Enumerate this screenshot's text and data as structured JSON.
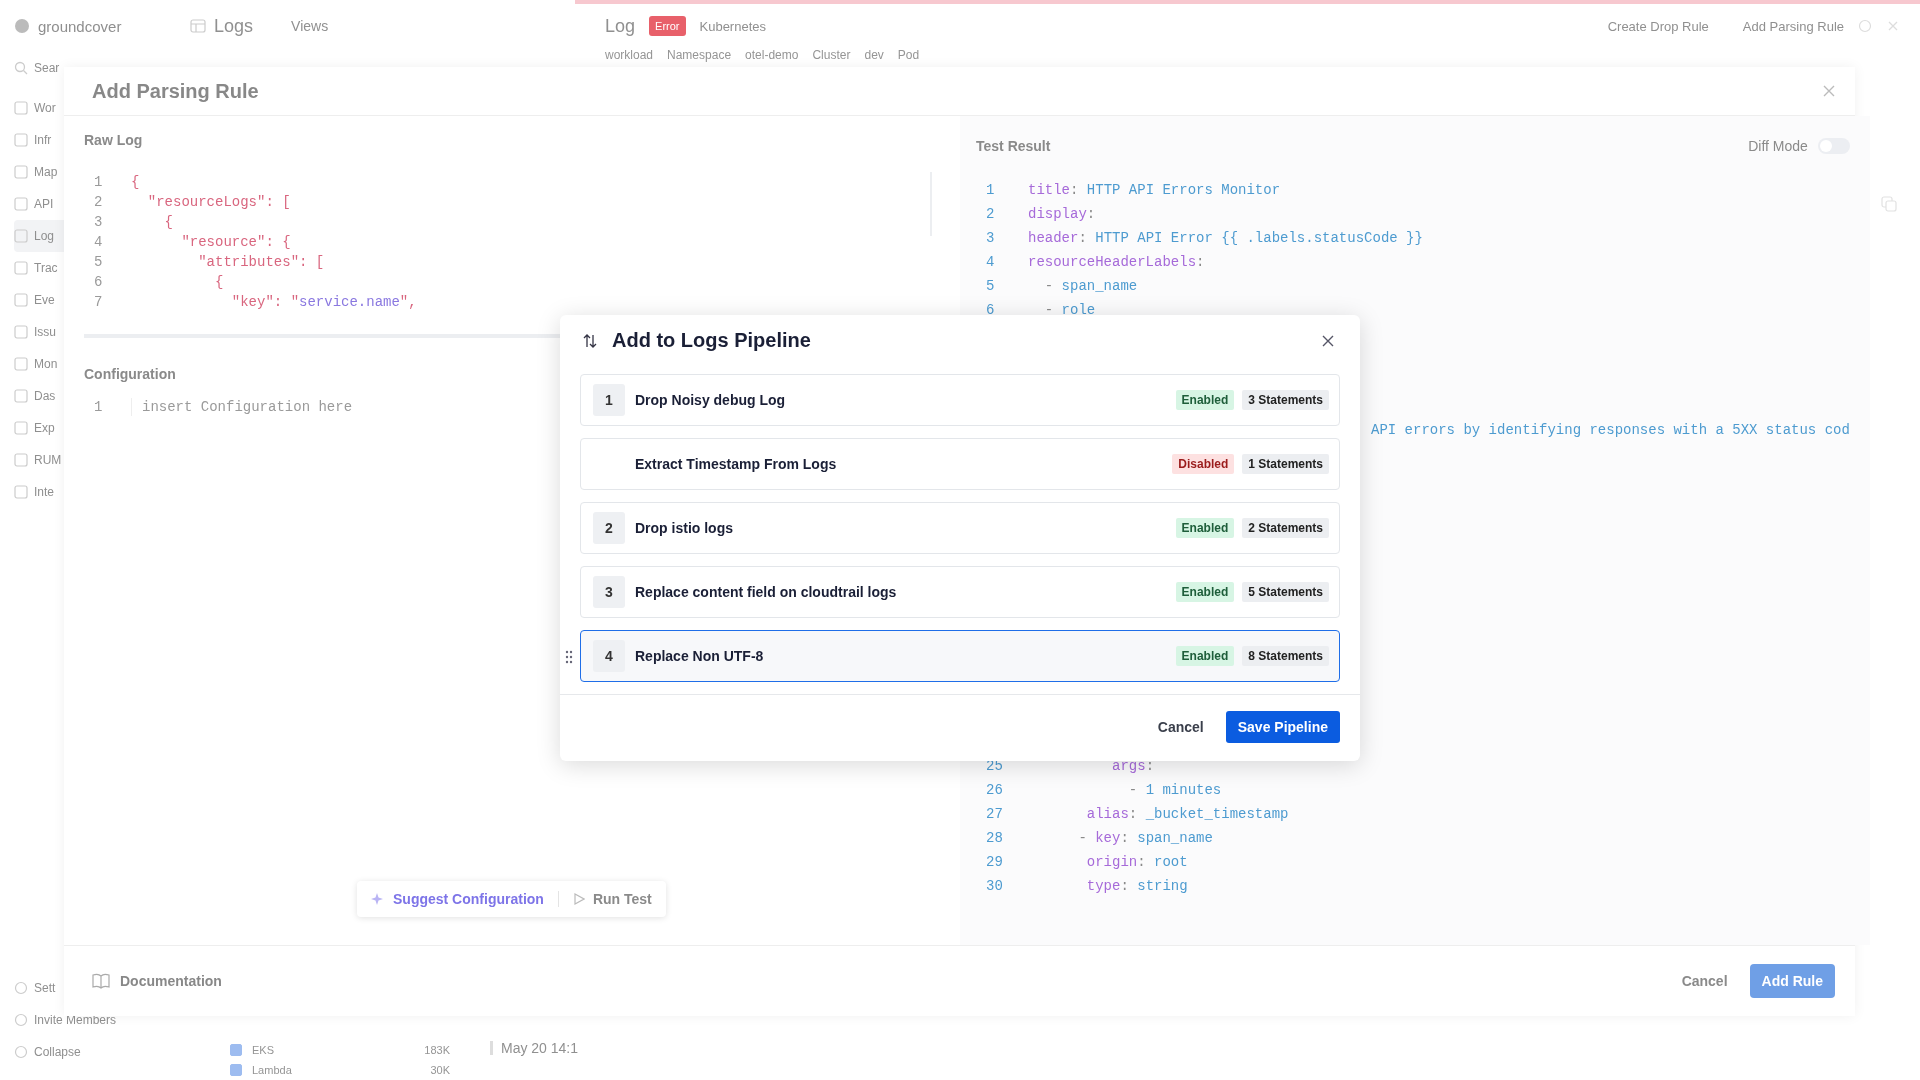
{
  "app": {
    "brand": "groundcover",
    "nav_title": "Logs",
    "views": "Views",
    "sidebar": {
      "search": "Sear",
      "items": [
        {
          "label": "Wor",
          "selected": false
        },
        {
          "label": "Infr",
          "selected": false
        },
        {
          "label": "Map",
          "selected": false
        },
        {
          "label": "API",
          "selected": false
        },
        {
          "label": "Log",
          "selected": true
        },
        {
          "label": "Trac",
          "selected": false
        },
        {
          "label": "Eve",
          "selected": false
        },
        {
          "label": "Issu",
          "selected": false
        },
        {
          "label": "Mon",
          "selected": false
        },
        {
          "label": "Das",
          "selected": false
        },
        {
          "label": "Exp",
          "selected": false
        },
        {
          "label": "RUM",
          "selected": false
        },
        {
          "label": "Inte",
          "selected": false
        }
      ],
      "bottom": [
        "Sett",
        "Invite Members",
        "Collapse"
      ]
    },
    "log_header": {
      "title": "Log",
      "level": "Error",
      "source": "Kubernetes",
      "actions": [
        "Create Drop Rule",
        "Add Parsing Rule"
      ],
      "fields": [
        "workload",
        "Namespace",
        "otel-demo",
        "Cluster",
        "dev",
        "Pod"
      ]
    },
    "table_fragment": {
      "rows": [
        {
          "label": "EKS",
          "count": "183K",
          "checked": true
        },
        {
          "label": "Lambda",
          "count": "30K",
          "checked": true
        }
      ],
      "time": "May 20 14:1"
    }
  },
  "drawer": {
    "title": "Add Parsing Rule",
    "raw_log": {
      "label": "Raw Log",
      "lines": [
        {
          "n": "1",
          "parts": [
            {
              "kind": "punct",
              "text": "{"
            }
          ]
        },
        {
          "n": "2",
          "parts": [
            {
              "kind": "punct",
              "text": "  \"resourceLogs\": ["
            }
          ]
        },
        {
          "n": "3",
          "parts": [
            {
              "kind": "punct",
              "text": "    {"
            }
          ]
        },
        {
          "n": "4",
          "parts": [
            {
              "kind": "punct",
              "text": "      \"resource\": {"
            }
          ]
        },
        {
          "n": "5",
          "parts": [
            {
              "kind": "punct",
              "text": "        \"attributes\": ["
            }
          ]
        },
        {
          "n": "6",
          "parts": [
            {
              "kind": "punct",
              "text": "          {"
            }
          ]
        },
        {
          "n": "7",
          "parts": [
            {
              "kind": "punct",
              "text": "            \"key\": \""
            },
            {
              "kind": "string",
              "text": "service.name"
            },
            {
              "kind": "punct",
              "text": "\","
            }
          ]
        }
      ]
    },
    "configuration": {
      "label": "Configuration",
      "line": "1",
      "placeholder": "insert Configuration here"
    },
    "tools": [
      "Suggest Configuration",
      "Run Test"
    ],
    "test_result": {
      "label": "Test Result",
      "diff_mode": {
        "label": "Diff Mode",
        "on": false
      },
      "lines_top": [
        {
          "n": "1",
          "parts": [
            {
              "kind": "key",
              "text": "title"
            },
            {
              "kind": "punct",
              "text": ": "
            },
            {
              "kind": "value",
              "text": "HTTP API Errors Monitor"
            }
          ]
        },
        {
          "n": "2",
          "parts": [
            {
              "kind": "key",
              "text": "display"
            },
            {
              "kind": "punct",
              "text": ":"
            }
          ]
        },
        {
          "n": "3",
          "parts": [
            {
              "kind": "key",
              "text": "header"
            },
            {
              "kind": "punct",
              "text": ": "
            },
            {
              "kind": "value",
              "text": "HTTP API Error {{ .labels.statusCode }}"
            }
          ]
        },
        {
          "n": "4",
          "parts": [
            {
              "kind": "key",
              "text": "resourceHeaderLabels"
            },
            {
              "kind": "punct",
              "text": ":"
            }
          ]
        },
        {
          "n": "5",
          "parts": [
            {
              "kind": "punct",
              "text": "  - "
            },
            {
              "kind": "value",
              "text": "span_name"
            }
          ]
        },
        {
          "n": "6",
          "parts": [
            {
              "kind": "punct",
              "text": "  - "
            },
            {
              "kind": "value",
              "text": "role"
            }
          ]
        }
      ],
      "partial_line": "API errors by identifying responses with a 5XX status cod",
      "lines_bottom": [
        {
          "n": "25",
          "parts": [
            {
              "kind": "key",
              "text": "          args"
            },
            {
              "kind": "punct",
              "text": ":"
            }
          ]
        },
        {
          "n": "26",
          "parts": [
            {
              "kind": "punct",
              "text": "            - "
            },
            {
              "kind": "value",
              "text": "1 minutes"
            }
          ]
        },
        {
          "n": "27",
          "parts": [
            {
              "kind": "key",
              "text": "       alias"
            },
            {
              "kind": "punct",
              "text": ": "
            },
            {
              "kind": "value",
              "text": "_bucket_timestamp"
            }
          ]
        },
        {
          "n": "28",
          "parts": [
            {
              "kind": "punct",
              "text": "      - "
            },
            {
              "kind": "key",
              "text": "key"
            },
            {
              "kind": "punct",
              "text": ": "
            },
            {
              "kind": "value",
              "text": "span_name"
            }
          ]
        },
        {
          "n": "29",
          "parts": [
            {
              "kind": "key",
              "text": "       origin"
            },
            {
              "kind": "punct",
              "text": ": "
            },
            {
              "kind": "value",
              "text": "root"
            }
          ]
        },
        {
          "n": "30",
          "parts": [
            {
              "kind": "key",
              "text": "       type"
            },
            {
              "kind": "punct",
              "text": ": "
            },
            {
              "kind": "value",
              "text": "string"
            }
          ]
        }
      ]
    },
    "footer": {
      "documentation": "Documentation",
      "cancel": "Cancel",
      "submit": "Add Rule"
    }
  },
  "modal": {
    "title": "Add to Logs Pipeline",
    "rows": [
      {
        "number": "1",
        "name": "Drop Noisy debug Log",
        "enabled": true,
        "status": "Enabled",
        "statements": "3 Statements",
        "selected": false
      },
      {
        "name": "Extract Timestamp From Logs",
        "enabled": false,
        "status": "Disabled",
        "statements": "1 Statements",
        "selected": false
      },
      {
        "number": "2",
        "name": "Drop istio logs",
        "enabled": true,
        "status": "Enabled",
        "statements": "2 Statements",
        "selected": false
      },
      {
        "number": "3",
        "name": "Replace content field on cloudtrail logs",
        "enabled": true,
        "status": "Enabled",
        "statements": "5 Statements",
        "selected": false
      },
      {
        "number": "4",
        "name": "Replace Non UTF-8",
        "enabled": true,
        "status": "Enabled",
        "statements": "8 Statements",
        "selected": true
      }
    ],
    "cancel": "Cancel",
    "save": "Save Pipeline"
  }
}
